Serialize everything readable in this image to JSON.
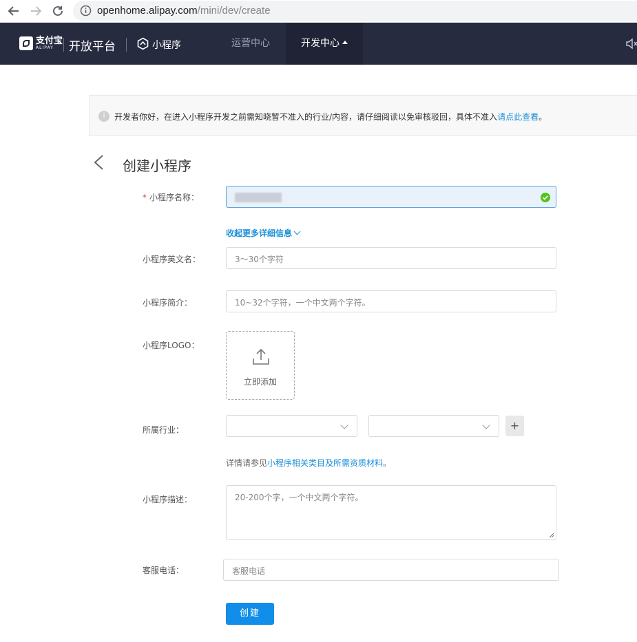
{
  "browser": {
    "url_domain": "openhome.alipay.com",
    "url_path": "/mini/dev/create"
  },
  "topnav": {
    "logo_cn": "支付宝",
    "logo_en": "ALIPAY",
    "platform_title": "开放平台",
    "mini_title": "小程序",
    "nav_items": [
      {
        "label": "运营中心"
      },
      {
        "label": "开发中心"
      }
    ]
  },
  "notice": {
    "icon_text": "i",
    "text": "开发者你好，在进入小程序开发之前需知晓暂不准入的行业/内容，请仔细阅读以免审核驳回，具体不准入",
    "link_text": "请点此查看",
    "suffix": "。"
  },
  "header": {
    "title": "创建小程序"
  },
  "form": {
    "name": {
      "required_mark": "*",
      "label": "小程序名称："
    },
    "collapse_link": "收起更多详细信息",
    "english_name": {
      "label": "小程序英文名：",
      "placeholder": "3～30个字符"
    },
    "brief": {
      "label": "小程序简介：",
      "placeholder": "10~32个字符，一个中文两个字符。"
    },
    "logo": {
      "label": "小程序LOGO：",
      "upload_text": "立即添加"
    },
    "industry": {
      "label": "所属行业：",
      "add_label": "+"
    },
    "hint": {
      "prefix": "详情请参见",
      "link": "小程序相关类目及所需资质材料",
      "suffix": "。"
    },
    "description": {
      "label": "小程序描述：",
      "placeholder": "20-200个字，一个中文两个字符。"
    },
    "phone": {
      "label": "客服电话：",
      "placeholder": "客服电话"
    },
    "submit_label": "创建"
  },
  "colors": {
    "nav_bg": "#272b40",
    "accent": "#108ee9",
    "link": "#1a8fd8",
    "success": "#52c41a",
    "required": "#e8413c"
  }
}
